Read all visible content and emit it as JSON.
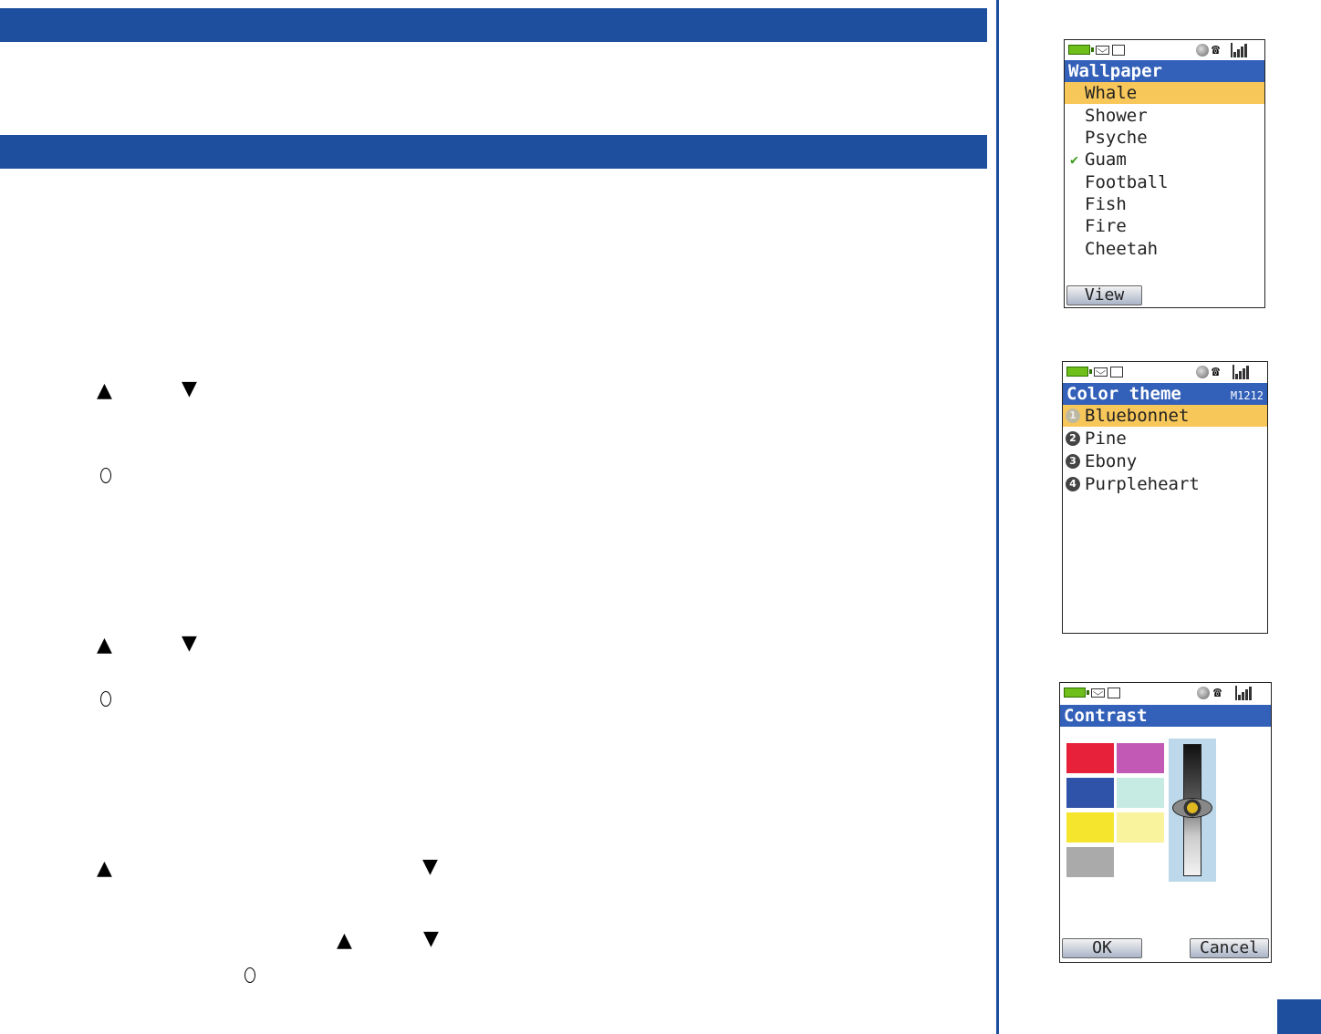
{
  "arrow_up": "▲",
  "arrow_down": "▼",
  "wallpaper_screen": {
    "title": "Wallpaper",
    "items": [
      "Whale",
      "Shower",
      "Psyche",
      "Guam",
      "Football",
      "Fish",
      "Fire",
      "Cheetah"
    ],
    "selected_item": "Whale",
    "checked_item": "Guam",
    "check_mark": "✔",
    "softkey_left": "View"
  },
  "color_theme_screen": {
    "title": "Color theme",
    "model_code": "M1212",
    "items": [
      {
        "num": "1",
        "label": "Bluebonnet"
      },
      {
        "num": "2",
        "label": "Pine"
      },
      {
        "num": "3",
        "label": "Ebony"
      },
      {
        "num": "4",
        "label": "Purpleheart"
      }
    ],
    "selected_item": "Bluebonnet"
  },
  "contrast_screen": {
    "title": "Contrast",
    "swatch_colors": [
      "#e8213a",
      "#c25ab5",
      "#2f53a8",
      "#c6ebe3",
      "#f5e52c",
      "#f8f39c",
      "#aaaaaa"
    ],
    "softkey_left": "OK",
    "softkey_right": "Cancel"
  },
  "colors": {
    "brand_blue": "#1d4f9e",
    "title_blue": "#3360b8",
    "highlight": "#f8c75a"
  }
}
